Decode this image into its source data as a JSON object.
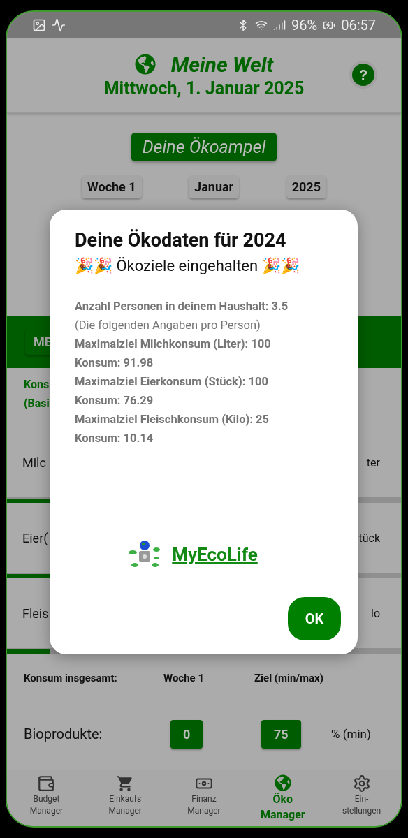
{
  "status_bar": {
    "battery": "96%",
    "time": "06:57"
  },
  "header": {
    "title": "Meine Welt",
    "date": "Mittwoch, 1. Januar 2025",
    "help": "?"
  },
  "ampel_button": "Deine Ökoampel",
  "period": [
    "Woche 1",
    "Januar",
    "2025"
  ],
  "tab_strip": {
    "tab": "ME"
  },
  "section_label": [
    "Kons",
    "(Basi"
  ],
  "rows": [
    {
      "left": "Milc",
      "right": "ter"
    },
    {
      "left": "Eier(",
      "right": "tück"
    },
    {
      "left": "Fleis",
      "right": "lo"
    }
  ],
  "totals": {
    "columns": [
      "Konsum insgesamt:",
      "Woche 1",
      "Ziel (min/max)"
    ],
    "rows": [
      {
        "label": "Bioprodukte:",
        "value": "0",
        "target": "75",
        "unit": "% (min)"
      }
    ]
  },
  "nav": [
    {
      "kind": "wallet",
      "lines": [
        "Budget",
        "Manager"
      ],
      "selected": false
    },
    {
      "kind": "cart",
      "lines": [
        "Einkaufs",
        "Manager"
      ],
      "selected": false
    },
    {
      "kind": "money",
      "lines": [
        "Finanz",
        "Manager"
      ],
      "selected": false
    },
    {
      "kind": "globe",
      "lines": [
        "Öko",
        "Manager"
      ],
      "selected": true
    },
    {
      "kind": "gear",
      "lines": [
        "Ein-",
        "stellungen"
      ],
      "selected": false
    }
  ],
  "dialog": {
    "title": "Deine Ökodaten für 2024",
    "subtitle": "🎉🎉 Ökoziele eingehalten 🎉🎉",
    "lines": [
      {
        "text": "Anzahl Personen in deinem Haushalt: 3.5",
        "bold": true
      },
      {
        "text": "(Die folgenden Angaben pro Person)",
        "bold": false
      },
      {
        "text": "Maximalziel Milchkonsum (Liter): 100",
        "bold": true
      },
      {
        "text": "Konsum: 91.98",
        "bold": true
      },
      {
        "text": "Maximalziel Eierkonsum (Stück): 100",
        "bold": true
      },
      {
        "text": "Konsum: 76.29",
        "bold": true
      },
      {
        "text": "Maximalziel Fleischkonsum (Kilo): 25",
        "bold": true
      },
      {
        "text": "Konsum: 10.14",
        "bold": true
      }
    ],
    "brand": "MyEcoLife",
    "button": "OK"
  }
}
